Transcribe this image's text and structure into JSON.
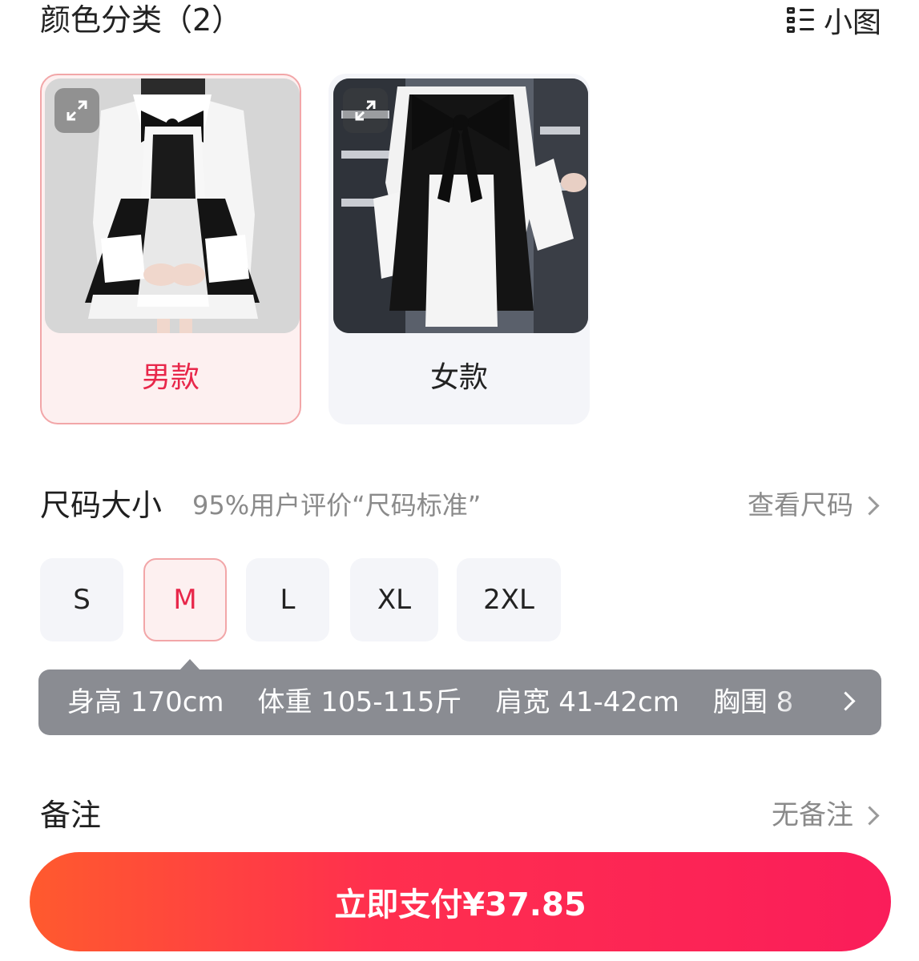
{
  "header": {
    "title": "颜色分类（2）",
    "view_toggle_label": "小图",
    "view_toggle_icon": "list-view-icon"
  },
  "variants": [
    {
      "label": "男款",
      "selected": true,
      "expand_icon": "expand-icon"
    },
    {
      "label": "女款",
      "selected": false,
      "expand_icon": "expand-icon"
    }
  ],
  "size": {
    "title": "尺码大小",
    "rating": "95%用户评价“尺码标准”",
    "chart_link": "查看尺码",
    "options": [
      {
        "label": "S",
        "selected": false
      },
      {
        "label": "M",
        "selected": true
      },
      {
        "label": "L",
        "selected": false
      },
      {
        "label": "XL",
        "selected": false
      },
      {
        "label": "2XL",
        "selected": false
      }
    ]
  },
  "size_tip": {
    "height": "身高 170cm",
    "weight": "体重 105-115斤",
    "shoulder": "肩宽 41-42cm",
    "chest": "胸围 8"
  },
  "remark": {
    "label": "备注",
    "value": "无备注"
  },
  "pay_button": {
    "label": "立即支付¥37.85"
  },
  "colors": {
    "accent": "#e8274a",
    "selected_border": "#f2a6a8",
    "selected_bg": "#fdf0f0",
    "option_bg": "#f4f5f9",
    "tooltip_bg": "#8a8c92",
    "pay_gradient_start": "#ff5a2e",
    "pay_gradient_end": "#fa1d5a"
  }
}
